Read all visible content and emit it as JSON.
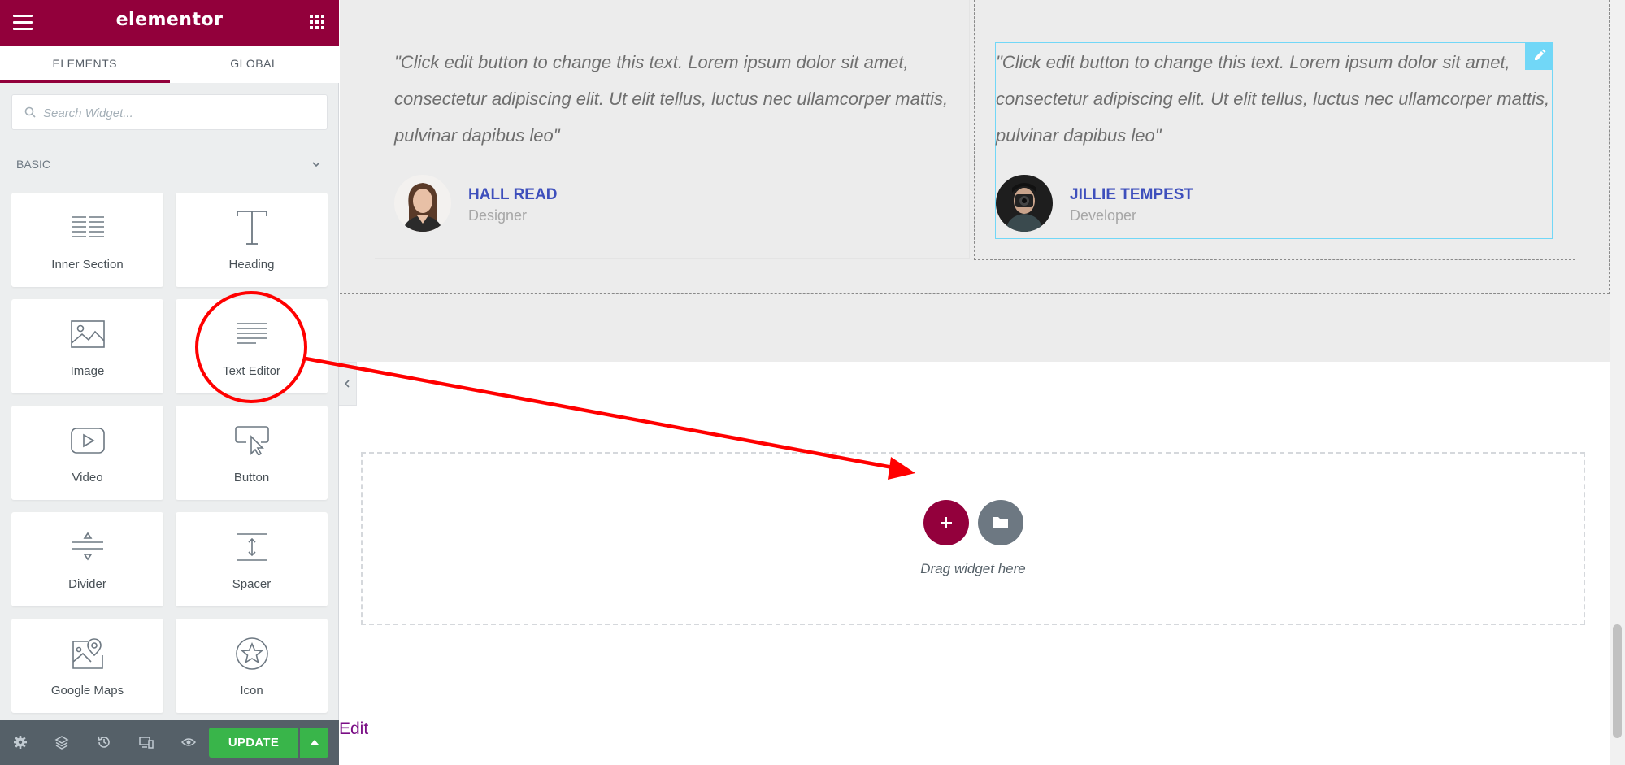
{
  "sidebar": {
    "logo": "elementor",
    "tabs": [
      {
        "label": "ELEMENTS"
      },
      {
        "label": "GLOBAL"
      }
    ],
    "search": {
      "placeholder": "Search Widget..."
    },
    "category": "BASIC",
    "widgets": [
      {
        "label": "Inner Section",
        "icon": "inner-section-icon"
      },
      {
        "label": "Heading",
        "icon": "heading-icon"
      },
      {
        "label": "Image",
        "icon": "image-icon"
      },
      {
        "label": "Text Editor",
        "icon": "text-editor-icon"
      },
      {
        "label": "Video",
        "icon": "video-icon"
      },
      {
        "label": "Button",
        "icon": "button-icon"
      },
      {
        "label": "Divider",
        "icon": "divider-icon"
      },
      {
        "label": "Spacer",
        "icon": "spacer-icon"
      },
      {
        "label": "Google Maps",
        "icon": "google-maps-icon"
      },
      {
        "label": "Icon",
        "icon": "star-icon"
      }
    ],
    "footer": {
      "update_label": "UPDATE"
    }
  },
  "canvas": {
    "testimonials": [
      {
        "quote": "\"Click edit button to change this text. Lorem ipsum dolor sit amet, consectetur adipiscing elit. Ut elit tellus, luctus nec ullamcorper mattis, pulvinar dapibus leo\"",
        "name": "HALL READ",
        "role": "Designer"
      },
      {
        "quote": "\"Click edit button to change this text. Lorem ipsum dolor sit amet, consectetur adipiscing elit. Ut elit tellus, luctus nec ullamcorper mattis, pulvinar dapibus leo\"",
        "name": "JILLIE TEMPEST",
        "role": "Developer"
      }
    ],
    "dropzone_text": "Drag widget here",
    "edit_link": "Edit"
  },
  "colors": {
    "brand": "#92003b",
    "update_green": "#39b54a",
    "name_blue": "#3e4fbc",
    "selection_cyan": "#71d7f7",
    "annotation_red": "#ff0000"
  }
}
